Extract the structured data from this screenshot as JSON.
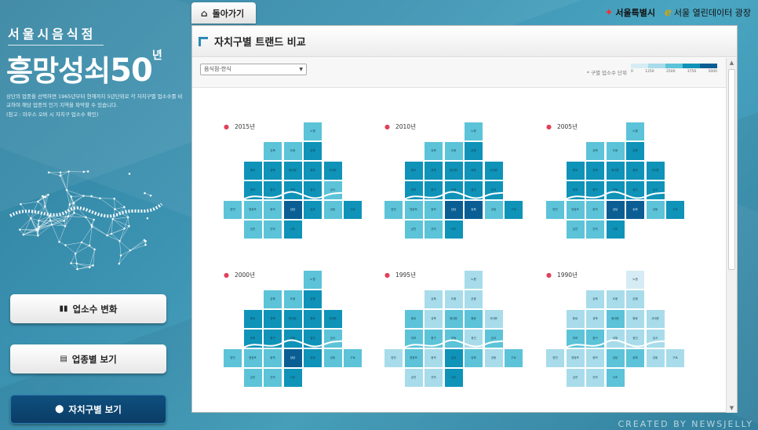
{
  "header": {
    "subtitle": "서울시음식점",
    "title_main": "흥망성쇠",
    "title_num": "50",
    "title_unit": "년",
    "description": "상단의 업종을 선택하면 1965년부터 현재까지 5년단위로 각 자치구별 업소수를 비교하여 해당 업종의 인기 지역을 파악할 수 있습니다.",
    "note": "(참고 : 마우스 오버 시 자치구 업소수 확인)"
  },
  "nav": {
    "back_label": "돌아가기",
    "buttons": [
      {
        "label": "업소수 변화",
        "icon": "bar-chart-icon"
      },
      {
        "label": "업종별 보기",
        "icon": "document-icon"
      },
      {
        "label": "자치구별 보기",
        "icon": "location-pin-icon"
      }
    ]
  },
  "logos": {
    "seoul": "서울특별시",
    "open_data": "서울 열린데이터 광장"
  },
  "panel": {
    "title": "자치구별 트랜드 비교",
    "select_value": "음식점-한식",
    "legend_title": "* 구별 업소수 단위",
    "legend_ticks": [
      "0",
      "1250",
      "2500",
      "3750",
      "5000"
    ],
    "legend_colors": [
      "#d6ecf4",
      "#a8dcea",
      "#5cc3d8",
      "#0f93b8",
      "#0a5e93"
    ]
  },
  "district_names": [
    "노원",
    "강북",
    "도봉",
    "은평",
    "종로",
    "성북",
    "동대문",
    "중랑",
    "서대문",
    "마포",
    "중구",
    "성동",
    "광진",
    "강서",
    "양천",
    "영등포",
    "동작",
    "강남",
    "송파",
    "강동",
    "구로",
    "금천",
    "관악",
    "서초"
  ],
  "maps": [
    {
      "year": "2015년",
      "levels": [
        2,
        2,
        2,
        3,
        3,
        3,
        3,
        3,
        3,
        3,
        3,
        3,
        3,
        2,
        2,
        2,
        2,
        4,
        3,
        2,
        3,
        2,
        2,
        3
      ]
    },
    {
      "year": "2010년",
      "levels": [
        2,
        2,
        2,
        3,
        3,
        3,
        3,
        3,
        3,
        3,
        3,
        3,
        3,
        3,
        2,
        2,
        2,
        4,
        4,
        2,
        3,
        2,
        2,
        3
      ]
    },
    {
      "year": "2005년",
      "levels": [
        2,
        2,
        2,
        3,
        3,
        3,
        3,
        3,
        3,
        3,
        3,
        3,
        3,
        3,
        2,
        2,
        2,
        4,
        4,
        2,
        3,
        2,
        2,
        3
      ]
    },
    {
      "year": "2000년",
      "levels": [
        2,
        2,
        2,
        3,
        3,
        3,
        3,
        3,
        3,
        3,
        3,
        3,
        3,
        2,
        2,
        2,
        2,
        4,
        3,
        2,
        2,
        2,
        2,
        3
      ]
    },
    {
      "year": "1995년",
      "levels": [
        1,
        1,
        1,
        1,
        2,
        1,
        2,
        2,
        1,
        2,
        2,
        2,
        1,
        2,
        1,
        2,
        1,
        3,
        2,
        1,
        2,
        1,
        1,
        3
      ]
    },
    {
      "year": "1990년",
      "levels": [
        0,
        1,
        1,
        1,
        1,
        1,
        2,
        1,
        1,
        2,
        2,
        1,
        1,
        1,
        1,
        1,
        1,
        2,
        2,
        1,
        1,
        1,
        1,
        2
      ]
    }
  ],
  "credit": "CREATED BY NEWSJELLY"
}
